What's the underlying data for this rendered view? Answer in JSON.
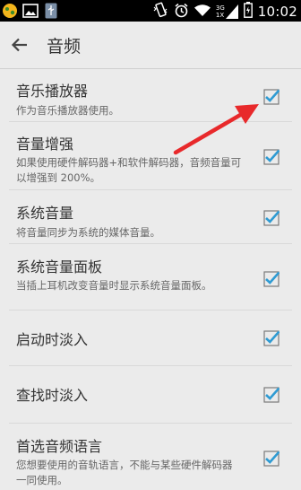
{
  "status_bar": {
    "time": "10:02",
    "network_3g": "3G",
    "network_1x": "1X",
    "icons": [
      "notification-app-icon",
      "image-icon",
      "usb-icon",
      "vibrate-icon",
      "alarm-icon",
      "wifi-icon",
      "signal-icon",
      "battery-icon"
    ]
  },
  "app_bar": {
    "title": "音频"
  },
  "settings": [
    {
      "label": "音乐播放器",
      "summary": "作为音乐播放器使用。",
      "checked": true
    },
    {
      "label": "音量增强",
      "summary": "如果使用硬件解码器+和软件解码器，音频音量可以增强到 200%。",
      "checked": true
    },
    {
      "label": "系统音量",
      "summary": "将音量同步为系统的媒体音量。",
      "checked": true
    },
    {
      "label": "系统音量面板",
      "summary": "当插上耳机改变音量时显示系统音量面板。",
      "checked": true
    },
    {
      "label": "启动时淡入",
      "summary": "",
      "checked": true
    },
    {
      "label": "查找时淡入",
      "summary": "",
      "checked": true
    },
    {
      "label": "首选音频语言",
      "summary": "您想要使用的音轨语言，不能与某些硬件解码器一同使用。",
      "checked": true
    }
  ],
  "colors": {
    "background": "#ebebeb",
    "checkbox": "#2f9bd3",
    "annotation_arrow": "#e8292b"
  }
}
